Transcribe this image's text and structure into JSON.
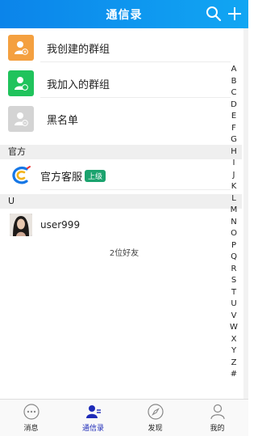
{
  "header": {
    "title": "通信录"
  },
  "groups": [
    {
      "label": "我创建的群组",
      "icon": "group-create-icon",
      "color": "#f4a040"
    },
    {
      "label": "我加入的群组",
      "icon": "group-join-icon",
      "color": "#20c35c"
    },
    {
      "label": "黑名单",
      "icon": "blacklist-icon",
      "color": "#d4d4d4"
    }
  ],
  "sections": {
    "official": {
      "title": "官方",
      "contact": {
        "name": "官方客服",
        "badge": "上级"
      }
    },
    "u": {
      "title": "U",
      "contact": {
        "name": "user999"
      }
    }
  },
  "friend_count": "2位好友",
  "index_letters": [
    "A",
    "B",
    "C",
    "D",
    "E",
    "F",
    "G",
    "H",
    "I",
    "J",
    "K",
    "L",
    "M",
    "N",
    "O",
    "P",
    "Q",
    "R",
    "S",
    "T",
    "U",
    "V",
    "W",
    "X",
    "Y",
    "Z",
    "#"
  ],
  "tabs": [
    {
      "label": "消息",
      "icon": "chat-icon"
    },
    {
      "label": "通信录",
      "icon": "contacts-icon",
      "active": true
    },
    {
      "label": "发现",
      "icon": "compass-icon"
    },
    {
      "label": "我的",
      "icon": "profile-icon"
    }
  ],
  "colors": {
    "header": "#0b84ea",
    "active_tab": "#1e2bb8",
    "badge": "#1ba36e"
  }
}
